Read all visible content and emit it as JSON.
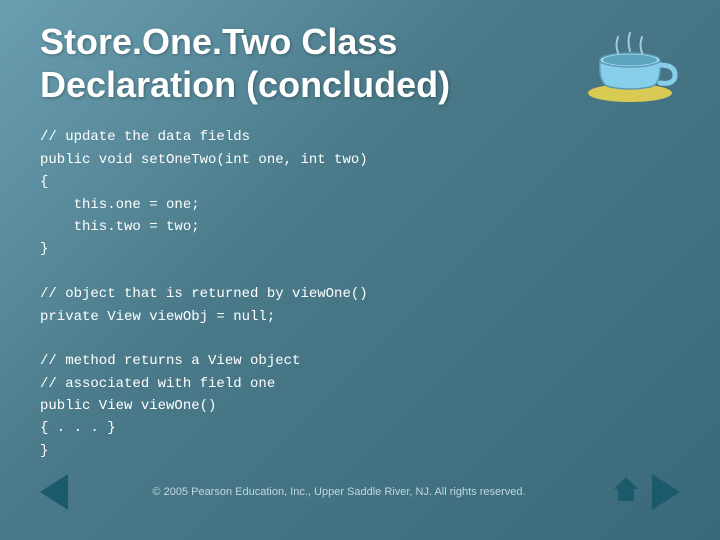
{
  "slide": {
    "title_line1": "Store.One.Two Class",
    "title_line2": "Declaration (concluded)",
    "code": "// update the data fields\npublic void setOneTwo(int one, int two)\n{\n    this.one = one;\n    this.two = two;\n}\n\n// object that is returned by viewOne()\nprivate View viewObj = null;\n\n// method returns a View object\n// associated with field one\npublic View viewOne()\n{ . . . }\n}",
    "copyright": "© 2005 Pearson Education, Inc., Upper Saddle River, NJ.  All rights reserved."
  },
  "icons": {
    "arrow_left": "◀",
    "arrow_right": "▶",
    "home": "⌂"
  }
}
